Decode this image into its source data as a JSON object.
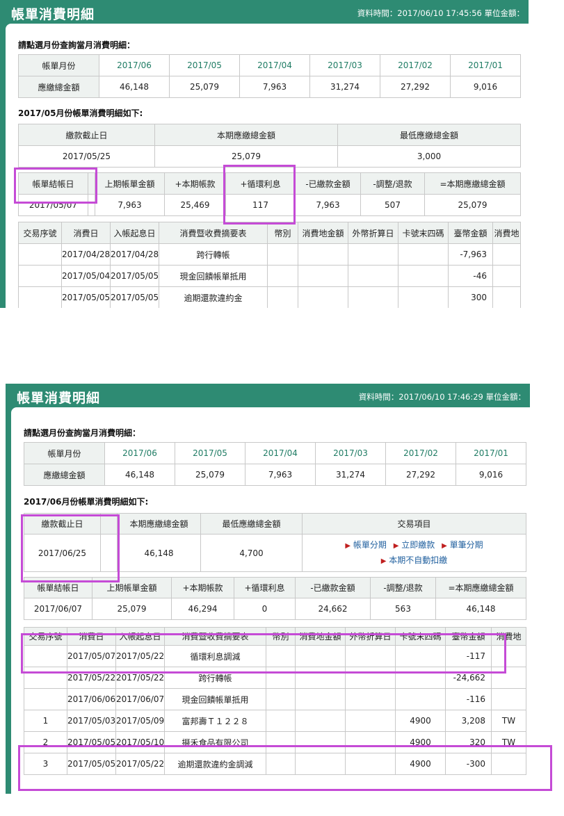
{
  "s1": {
    "title": "帳單消費明細",
    "info": "資料時間：2017/06/10 17:45:56 單位金額：",
    "prompt": "請點選月份查詢當月消費明細：",
    "months_label": "帳單月份",
    "amount_label": "應繳總金額",
    "months": [
      "2017/06",
      "2017/05",
      "2017/04",
      "2017/03",
      "2017/02",
      "2017/01"
    ],
    "amounts": [
      "46,148",
      "25,079",
      "7,963",
      "31,274",
      "27,292",
      "9,016"
    ],
    "section": "2017/05月份帳單消費明細如下:",
    "due": {
      "headers": [
        "繳款截止日",
        "本期應繳總金額",
        "最低應繳總金額"
      ],
      "values": [
        "2017/05/25",
        "25,079",
        "3,000"
      ]
    },
    "summary": {
      "headers": [
        "帳單結帳日",
        "上期帳單金額",
        "+本期帳款",
        "+循環利息",
        "-已繳款金額",
        "-調整/退款",
        "=本期應繳總金額"
      ],
      "values": [
        "2017/05/07",
        "7,963",
        "25,469",
        "117",
        "7,963",
        "507",
        "25,079"
      ]
    },
    "tx_headers": [
      "交易序號",
      "消費日",
      "入帳起息日",
      "消費暨收費摘要表",
      "幣別",
      "消費地金額",
      "外幣折算日",
      "卡號末四碼",
      "臺幣金額",
      "消費地"
    ],
    "tx_rows": [
      [
        "",
        "2017/04/28",
        "2017/04/28",
        "跨行轉帳",
        "",
        "",
        "",
        "",
        "-7,963",
        ""
      ],
      [
        "",
        "2017/05/04",
        "2017/05/05",
        "現金回饋帳單抵用",
        "",
        "",
        "",
        "",
        "-46",
        ""
      ],
      [
        "",
        "2017/05/05",
        "2017/05/05",
        "逾期還款違約金",
        "",
        "",
        "",
        "",
        "300",
        ""
      ]
    ]
  },
  "s2": {
    "title": "帳單消費明細",
    "info": "資料時間：2017/06/10 17:46:29 單位金額：",
    "prompt": "請點選月份查詢當月消費明細：",
    "months_label": "帳單月份",
    "amount_label": "應繳總金額",
    "months": [
      "2017/06",
      "2017/05",
      "2017/04",
      "2017/03",
      "2017/02",
      "2017/01"
    ],
    "amounts": [
      "46,148",
      "25,079",
      "7,963",
      "31,274",
      "27,292",
      "9,016"
    ],
    "section": "2017/06月份帳單消費明細如下:",
    "due": {
      "headers": [
        "繳款截止日",
        "本期應繳總金額",
        "最低應繳總金額",
        "交易項目"
      ],
      "values": [
        "2017/06/25",
        "46,148",
        "4,700"
      ]
    },
    "actions": [
      "帳單分期",
      "立即繳款",
      "單筆分期",
      "本期不自動扣繳"
    ],
    "summary": {
      "headers": [
        "帳單結帳日",
        "上期帳單金額",
        "+本期帳款",
        "+循環利息",
        "-已繳款金額",
        "-調整/退款",
        "=本期應繳總金額"
      ],
      "values": [
        "2017/06/07",
        "25,079",
        "46,294",
        "0",
        "24,662",
        "563",
        "46,148"
      ]
    },
    "tx_headers": [
      "交易序號",
      "消費日",
      "入帳起息日",
      "消費暨收費摘要表",
      "幣別",
      "消費地金額",
      "外幣折算日",
      "卡號末四碼",
      "臺幣金額",
      "消費地"
    ],
    "tx_rows": [
      [
        "",
        "2017/05/07",
        "2017/05/22",
        "循環利息調減",
        "",
        "",
        "",
        "",
        "-117",
        ""
      ],
      [
        "",
        "2017/05/22",
        "2017/05/22",
        "跨行轉帳",
        "",
        "",
        "",
        "",
        "-24,662",
        ""
      ],
      [
        "",
        "2017/06/06",
        "2017/06/07",
        "現金回饋帳單抵用",
        "",
        "",
        "",
        "",
        "-116",
        ""
      ],
      [
        "1",
        "2017/05/03",
        "2017/05/09",
        "富邦壽Ｔ１２２８",
        "",
        "",
        "",
        "4900",
        "3,208",
        "TW"
      ],
      [
        "2",
        "2017/05/05",
        "2017/05/10",
        "摄禾食品有限公司",
        "",
        "",
        "",
        "4900",
        "320",
        "TW"
      ],
      [
        "3",
        "2017/05/05",
        "2017/05/22",
        "逾期還款違約金調減",
        "",
        "",
        "",
        "4900",
        "-300",
        ""
      ]
    ]
  },
  "colors": {
    "header_green": "#2e8b73",
    "link_green": "#1f7c64",
    "highlight": "#c54bd6",
    "arrow_red": "#c02020"
  },
  "icons": {
    "action_arrow": "triangle-right-icon"
  }
}
